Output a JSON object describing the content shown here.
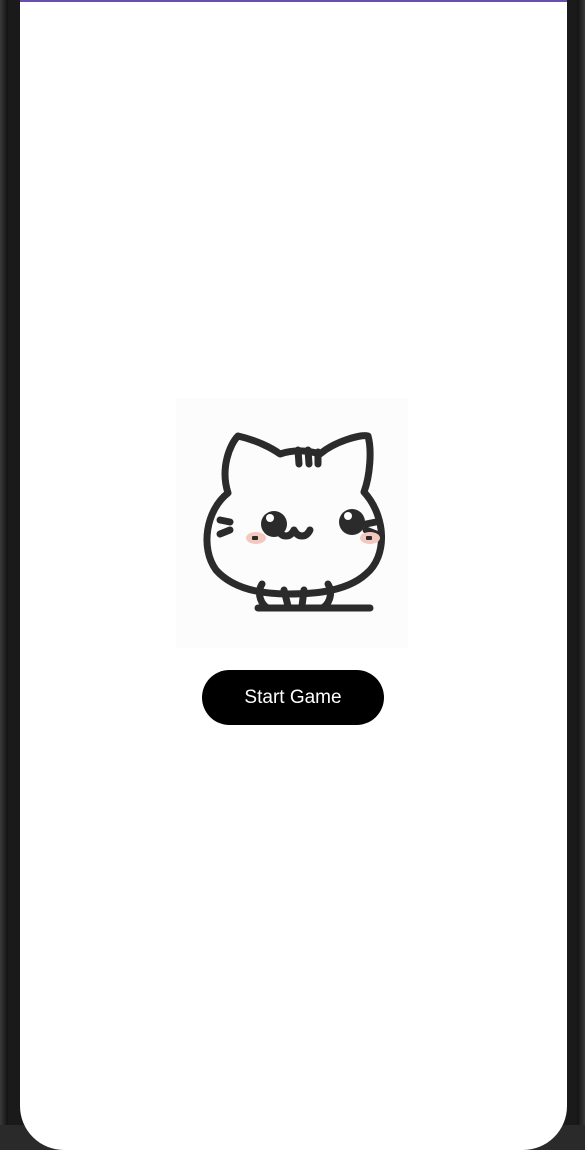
{
  "colors": {
    "accent_strip": "#6a4fb0",
    "button_background": "#000000",
    "button_text": "#ffffff",
    "cat_outline": "#2b2b2b",
    "cheek_blush": "#f3c9bf"
  },
  "mascot": {
    "icon": "cat-mascot-icon"
  },
  "start_button": {
    "label": "Start Game"
  }
}
